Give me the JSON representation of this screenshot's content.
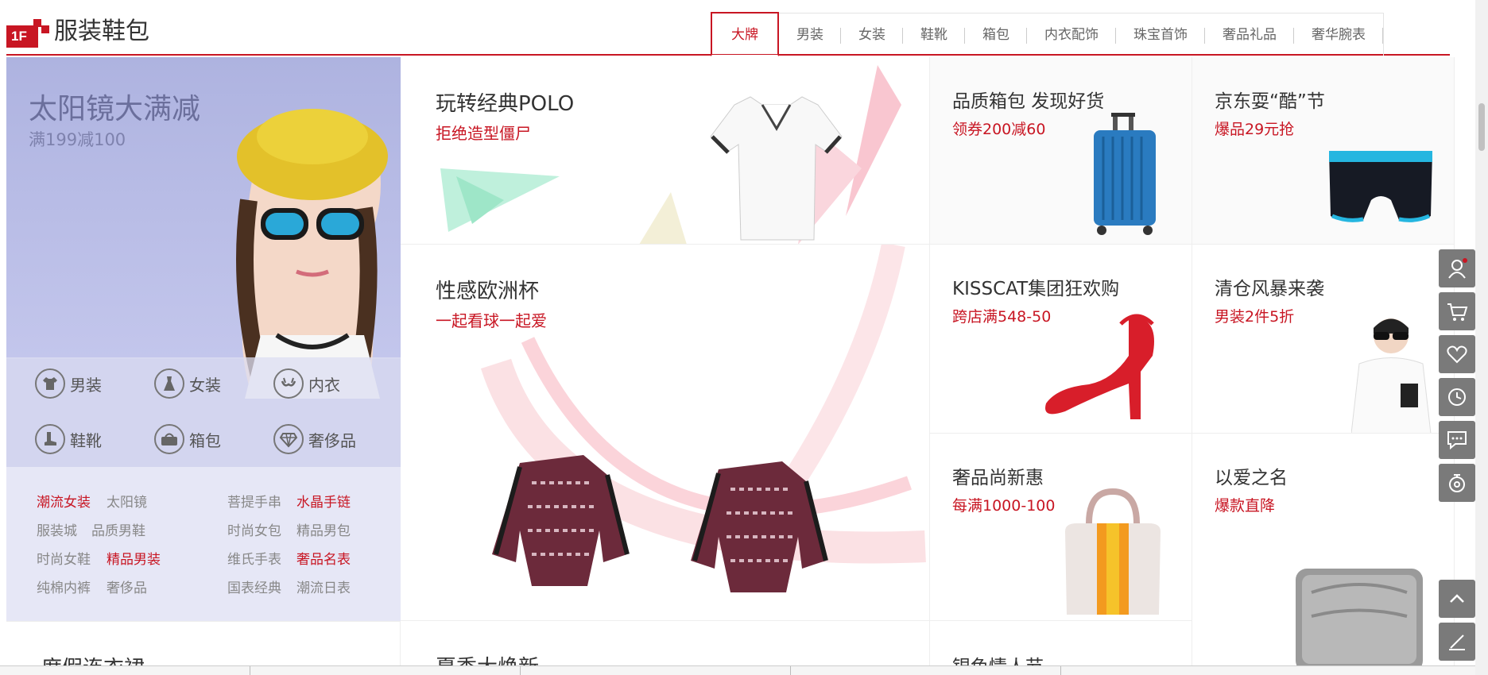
{
  "floor": {
    "number": "1F",
    "title": "服装鞋包"
  },
  "tabs": [
    "大牌",
    "男装",
    "女装",
    "鞋靴",
    "箱包",
    "内衣配饰",
    "珠宝首饰",
    "奢品礼品",
    "奢华腕表"
  ],
  "active_tab": "大牌",
  "hero": {
    "title": "太阳镜大满减",
    "subtitle": "满199减100"
  },
  "categories": [
    {
      "label": "男装",
      "icon": "tshirt-icon"
    },
    {
      "label": "女装",
      "icon": "dress-icon"
    },
    {
      "label": "内衣",
      "icon": "bra-icon"
    },
    {
      "label": "鞋靴",
      "icon": "boot-icon"
    },
    {
      "label": "箱包",
      "icon": "bag-icon"
    },
    {
      "label": "奢侈品",
      "icon": "diamond-icon"
    }
  ],
  "links": [
    {
      "label": "潮流女装",
      "hot": true
    },
    {
      "label": "太阳镜",
      "hot": false
    },
    {
      "label": "菩提手串",
      "hot": false
    },
    {
      "label": "水晶手链",
      "hot": true
    },
    {
      "label": "服装城",
      "hot": false
    },
    {
      "label": "品质男鞋",
      "hot": false
    },
    {
      "label": "时尚女包",
      "hot": false
    },
    {
      "label": "精品男包",
      "hot": false
    },
    {
      "label": "时尚女鞋",
      "hot": false
    },
    {
      "label": "精品男装",
      "hot": true
    },
    {
      "label": "维氏手表",
      "hot": false
    },
    {
      "label": "奢品名表",
      "hot": true
    },
    {
      "label": "纯棉内裤",
      "hot": false
    },
    {
      "label": "奢侈品",
      "hot": false
    },
    {
      "label": "国表经典",
      "hot": false
    },
    {
      "label": "潮流日表",
      "hot": false
    }
  ],
  "promos": {
    "polo": {
      "title": "玩转经典POLO",
      "sub": "拒绝造型僵尸"
    },
    "euro": {
      "title": "性感欧洲杯",
      "sub": "一起看球一起爱"
    },
    "luggage": {
      "title": "品质箱包 发现好货",
      "sub": "领券200减60"
    },
    "jd": {
      "title": "京东耍“酷”节",
      "sub": "爆品29元抢"
    },
    "kisscat": {
      "title": "KISSCAT集团狂欢购",
      "sub": "跨店满548-50"
    },
    "clearance": {
      "title": "清仓风暴来袭",
      "sub": "男装2件5折"
    },
    "luxury": {
      "title": "奢品尚新惠",
      "sub": "每满1000-100"
    },
    "love": {
      "title": "以爱之名",
      "sub": "爆款直降"
    },
    "b1": {
      "title": "度假连衣裙"
    },
    "b2": {
      "title": "夏季大焕新"
    },
    "b3": {
      "title": "银色情人节"
    }
  },
  "carousel": {
    "count": 4,
    "active_index": 3
  },
  "sidebar": [
    "user-icon",
    "cart-icon",
    "heart-icon",
    "history-icon",
    "message-icon",
    "service-icon"
  ],
  "colors": {
    "accent": "#c81623",
    "hero_bg": "#b9bde5",
    "sidebar_bg": "#7a7a7a"
  }
}
